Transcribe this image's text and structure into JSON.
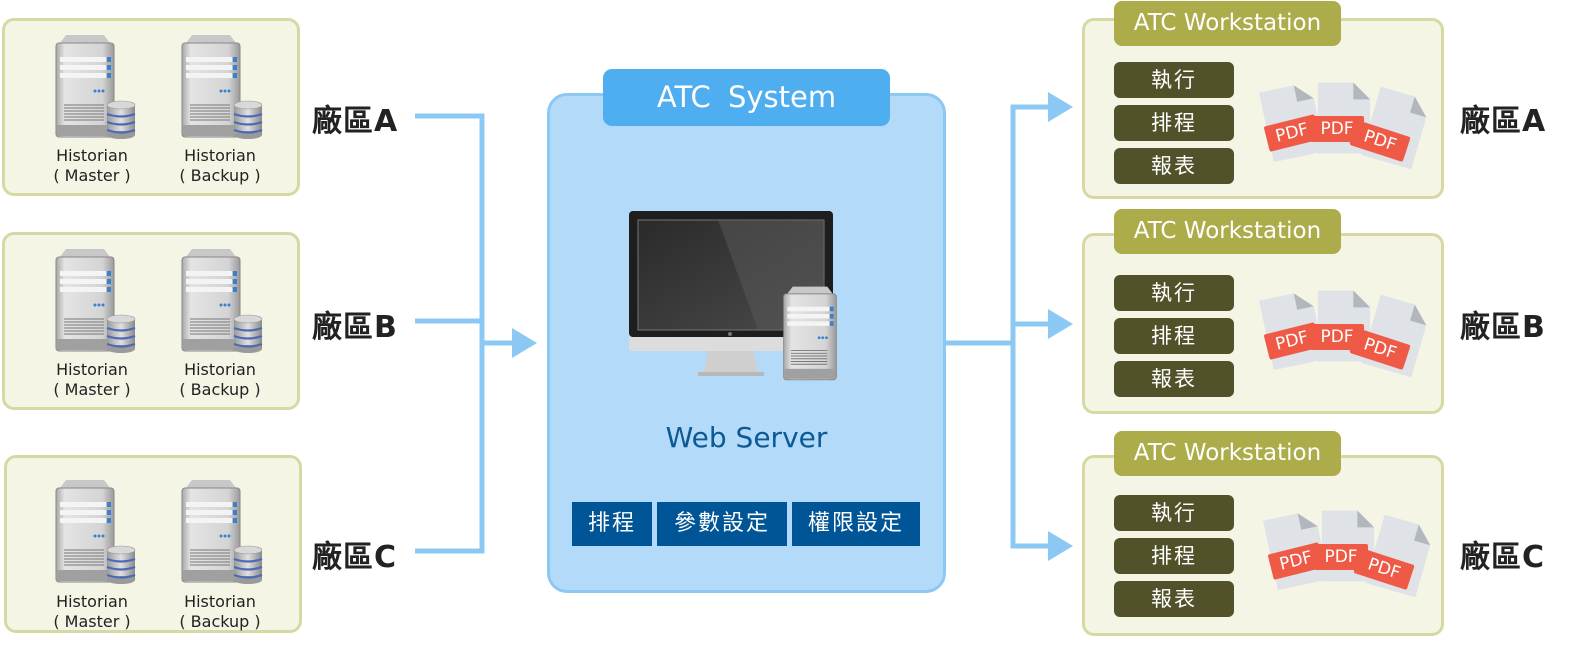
{
  "left_plants": [
    {
      "label": "廠區A",
      "servers": [
        {
          "name": "Historian",
          "role": "( Master )"
        },
        {
          "name": "Historian",
          "role": "( Backup )"
        }
      ]
    },
    {
      "label": "廠區B",
      "servers": [
        {
          "name": "Historian",
          "role": "( Master )"
        },
        {
          "name": "Historian",
          "role": "( Backup )"
        }
      ]
    },
    {
      "label": "廠區C",
      "servers": [
        {
          "name": "Historian",
          "role": "( Master )"
        },
        {
          "name": "Historian",
          "role": "( Backup )"
        }
      ]
    }
  ],
  "atc_system": {
    "title": "ATC  System",
    "icon": "monitor-and-server-icon",
    "subtitle": "Web Server",
    "buttons": [
      "排程",
      "參數設定",
      "權限設定"
    ]
  },
  "workstations": [
    {
      "title": "ATC Workstation",
      "buttons": [
        "執行",
        "排程",
        "報表"
      ],
      "pdf_labels": [
        "PDF",
        "PDF",
        "PDF"
      ],
      "plant_label": "廠區A"
    },
    {
      "title": "ATC Workstation",
      "buttons": [
        "執行",
        "排程",
        "報表"
      ],
      "pdf_labels": [
        "PDF",
        "PDF",
        "PDF"
      ],
      "plant_label": "廠區B"
    },
    {
      "title": "ATC Workstation",
      "buttons": [
        "執行",
        "排程",
        "報表"
      ],
      "pdf_labels": [
        "PDF",
        "PDF",
        "PDF"
      ],
      "plant_label": "廠區C"
    }
  ],
  "colors": {
    "connector": "#8cc8f4",
    "system_panel": "#b3daf8",
    "system_title": "#4faef0",
    "system_button": "#005596",
    "workstation_title": "#adac4b",
    "workstation_button": "#52522a",
    "pdf_badge": "#ef5a46",
    "panel_bg": "#f5f5e6"
  }
}
